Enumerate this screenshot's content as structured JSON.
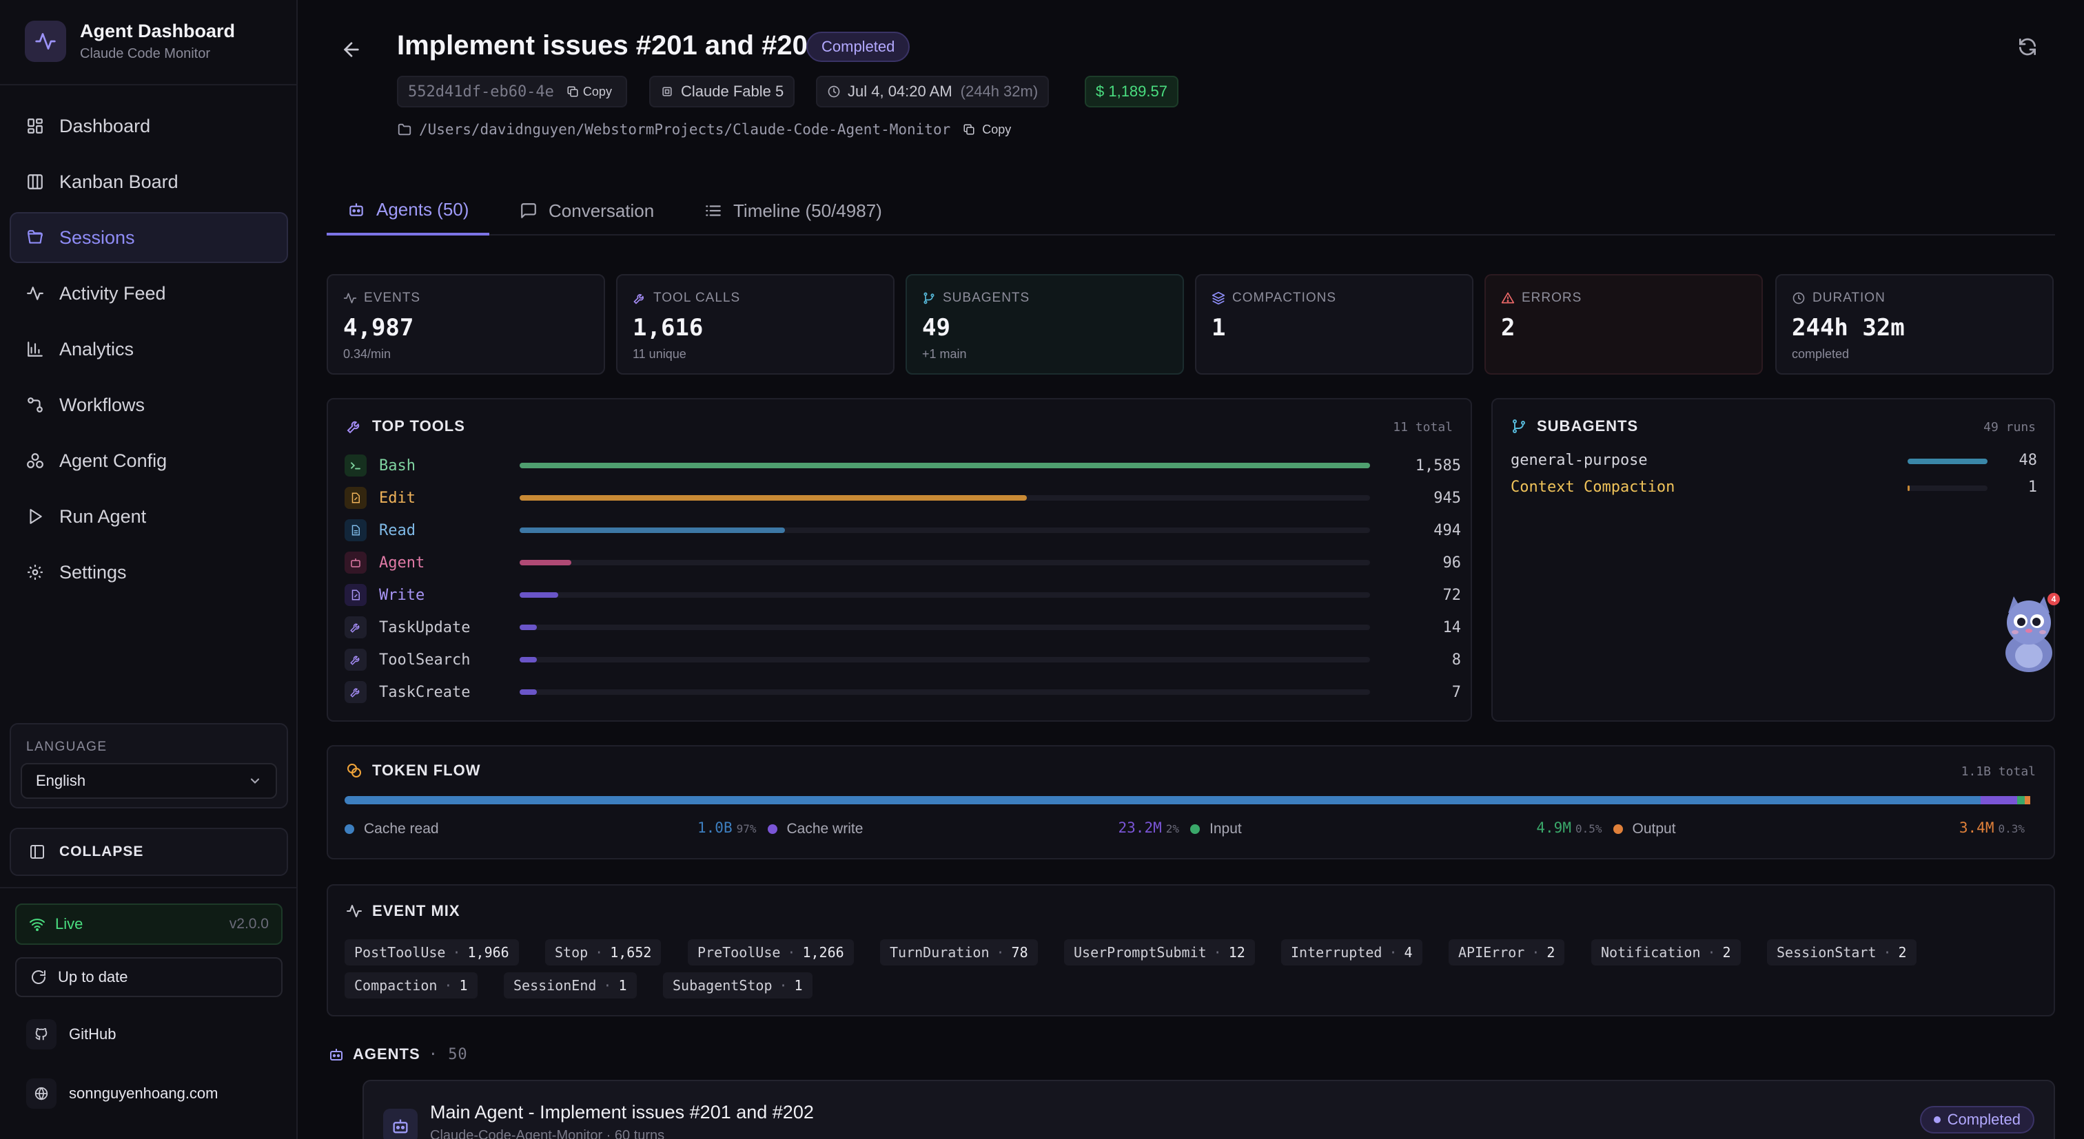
{
  "sidebar": {
    "app_title": "Agent Dashboard",
    "app_subtitle": "Claude Code Monitor",
    "nav": [
      {
        "label": "Dashboard",
        "icon": "grid-icon"
      },
      {
        "label": "Kanban Board",
        "icon": "columns-icon"
      },
      {
        "label": "Sessions",
        "icon": "folder-open-icon",
        "active": true
      },
      {
        "label": "Activity Feed",
        "icon": "activity-icon"
      },
      {
        "label": "Analytics",
        "icon": "bar-chart-icon"
      },
      {
        "label": "Workflows",
        "icon": "workflow-icon"
      },
      {
        "label": "Agent Config",
        "icon": "agent-config-icon"
      },
      {
        "label": "Run Agent",
        "icon": "play-icon"
      },
      {
        "label": "Settings",
        "icon": "gear-icon"
      }
    ],
    "language_label": "LANGUAGE",
    "language_value": "English",
    "collapse_label": "COLLAPSE",
    "live_label": "Live",
    "version": "v2.0.0",
    "update_label": "Up to date",
    "github_label": "GitHub",
    "website_label": "sonnguyenhoang.com"
  },
  "header": {
    "title": "Implement issues #201 and #202",
    "status": "Completed",
    "session_id": "552d41df-eb60-4e",
    "copy_label": "Copy",
    "model": "Claude Fable 5",
    "started": "Jul 4, 04:20 AM",
    "duration": "(244h 32m)",
    "cost": "$ 1,189.57",
    "path": "/Users/davidnguyen/WebstormProjects/Claude-Code-Agent-Monitor",
    "path_copy_label": "Copy"
  },
  "tabs": [
    {
      "label": "Agents (50)",
      "active": true
    },
    {
      "label": "Conversation"
    },
    {
      "label": "Timeline (50/4987)"
    }
  ],
  "stats": [
    {
      "label": "EVENTS",
      "value": "4,987",
      "sub": "0.34/min",
      "icon": "activity-icon",
      "accent": "#12121a"
    },
    {
      "label": "TOOL CALLS",
      "value": "1,616",
      "sub": "11 unique",
      "icon": "wrench-icon",
      "accent": "#12121a"
    },
    {
      "label": "SUBAGENTS",
      "value": "49",
      "sub": "+1 main",
      "icon": "git-branch-icon",
      "accent": "#0f1a1a"
    },
    {
      "label": "COMPACTIONS",
      "value": "1",
      "sub": "",
      "icon": "layers-icon",
      "accent": "#12121a"
    },
    {
      "label": "ERRORS",
      "value": "2",
      "sub": "",
      "icon": "alert-triangle-icon",
      "accent": "#1a1014"
    },
    {
      "label": "DURATION",
      "value": "244h 32m",
      "sub": "completed",
      "icon": "clock-icon",
      "accent": "#12121a"
    }
  ],
  "top_tools": {
    "title": "TOP TOOLS",
    "meta": "11 total",
    "max": 1585,
    "items": [
      {
        "name": "Bash",
        "count": 1585,
        "count_label": "1,585",
        "color": "#4f9f6f",
        "name_color": "#7fd3a0",
        "icon_bg": "#16301f"
      },
      {
        "name": "Edit",
        "count": 945,
        "count_label": "945",
        "color": "#c98a35",
        "name_color": "#f0b35a",
        "icon_bg": "#33260f"
      },
      {
        "name": "Read",
        "count": 494,
        "count_label": "494",
        "color": "#3d78a6",
        "name_color": "#7fb9e6",
        "icon_bg": "#12263a"
      },
      {
        "name": "Agent",
        "count": 96,
        "count_label": "96",
        "color": "#b04a75",
        "name_color": "#e07aa6",
        "icon_bg": "#331626"
      },
      {
        "name": "Write",
        "count": 72,
        "count_label": "72",
        "color": "#6a55c8",
        "name_color": "#a895f5",
        "icon_bg": "#221a3d"
      },
      {
        "name": "TaskUpdate",
        "count": 14,
        "count_label": "14",
        "color": "#6a55c8",
        "name_color": "#c9c9d2",
        "icon_bg": "#1e1e2b"
      },
      {
        "name": "ToolSearch",
        "count": 8,
        "count_label": "8",
        "color": "#6a55c8",
        "name_color": "#c9c9d2",
        "icon_bg": "#1e1e2b"
      },
      {
        "name": "TaskCreate",
        "count": 7,
        "count_label": "7",
        "color": "#6a55c8",
        "name_color": "#c9c9d2",
        "icon_bg": "#1e1e2b"
      }
    ]
  },
  "subagents": {
    "title": "SUBAGENTS",
    "meta": "49 runs",
    "max": 48,
    "items": [
      {
        "name": "general-purpose",
        "count": 48,
        "count_label": "48",
        "color": "#3a87a8",
        "name_color": "#d6d6de"
      },
      {
        "name": "Context Compaction",
        "count": 1,
        "count_label": "1",
        "color": "#c98a35",
        "name_color": "#f0c35a"
      }
    ]
  },
  "token_flow": {
    "title": "TOKEN FLOW",
    "meta": "1.1B total",
    "segments": [
      {
        "label": "Cache read",
        "value": "1.0B",
        "pct": "97%",
        "share": 0.9672,
        "color": "#3d7fc0"
      },
      {
        "label": "Cache write",
        "value": "23.2M",
        "pct": "2%",
        "share": 0.0216,
        "color": "#7a55d6"
      },
      {
        "label": "Input",
        "value": "4.9M",
        "pct": "0.5%",
        "share": 0.0046,
        "color": "#3aa86a"
      },
      {
        "label": "Output",
        "value": "3.4M",
        "pct": "0.3%",
        "share": 0.0032,
        "color": "#e0803a"
      }
    ]
  },
  "event_mix": {
    "title": "EVENT MIX",
    "items": [
      {
        "name": "PostToolUse",
        "count": "1,966"
      },
      {
        "name": "Stop",
        "count": "1,652"
      },
      {
        "name": "PreToolUse",
        "count": "1,266"
      },
      {
        "name": "TurnDuration",
        "count": "78"
      },
      {
        "name": "UserPromptSubmit",
        "count": "12"
      },
      {
        "name": "Interrupted",
        "count": "4"
      },
      {
        "name": "APIError",
        "count": "2"
      },
      {
        "name": "Notification",
        "count": "2"
      },
      {
        "name": "SessionStart",
        "count": "2"
      },
      {
        "name": "Compaction",
        "count": "1"
      },
      {
        "name": "SessionEnd",
        "count": "1"
      },
      {
        "name": "SubagentStop",
        "count": "1"
      }
    ]
  },
  "agents": {
    "heading": "AGENTS",
    "count": "50",
    "main": {
      "title": "Main Agent - Implement issues #201 and #202",
      "subtitle": "Claude-Code-Agent-Monitor · 60 turns",
      "status": "Completed"
    }
  },
  "mascot": {
    "badge": "4"
  }
}
